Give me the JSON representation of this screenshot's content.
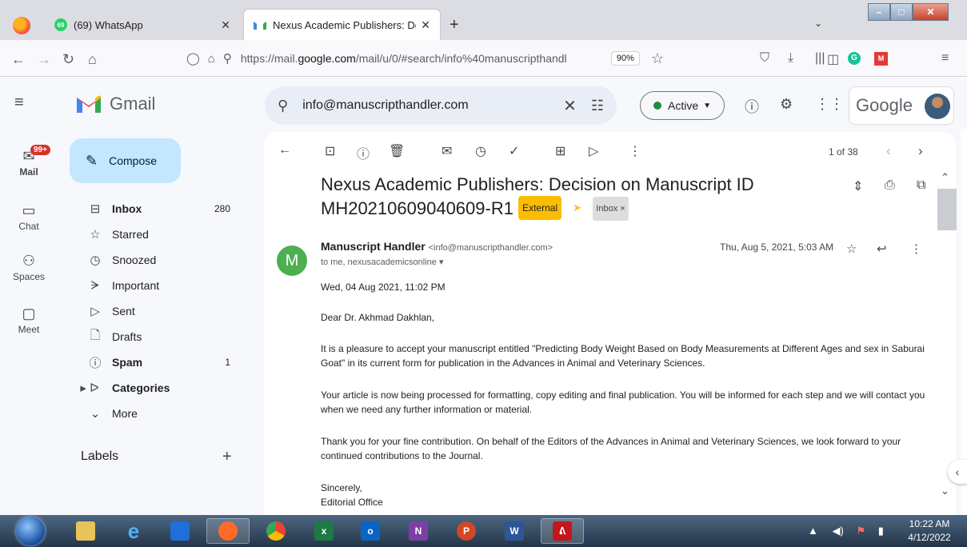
{
  "browser": {
    "tabs": [
      {
        "title": "(69) WhatsApp",
        "badge": "69"
      },
      {
        "title": "Nexus Academic Publishers: Dec"
      }
    ],
    "url_prefix": "https://mail.",
    "url_domain": "google.com",
    "url_suffix": "/mail/u/0/#search/info%40manuscripthandl",
    "zoom": "90%"
  },
  "gmail": {
    "app_name": "Gmail",
    "search_value": "info@manuscripthandler.com",
    "status": "Active",
    "google_word": "Google"
  },
  "rail": {
    "mail": "Mail",
    "mail_badge": "99+",
    "chat": "Chat",
    "spaces": "Spaces",
    "meet": "Meet"
  },
  "sidebar": {
    "compose": "Compose",
    "items": [
      {
        "label": "Inbox",
        "count": "280"
      },
      {
        "label": "Starred",
        "count": ""
      },
      {
        "label": "Snoozed",
        "count": ""
      },
      {
        "label": "Important",
        "count": ""
      },
      {
        "label": "Sent",
        "count": ""
      },
      {
        "label": "Drafts",
        "count": ""
      },
      {
        "label": "Spam",
        "count": "1"
      },
      {
        "label": "Categories",
        "count": ""
      },
      {
        "label": "More",
        "count": ""
      }
    ],
    "labels_header": "Labels"
  },
  "message": {
    "pager": "1 of 38",
    "subject": "Nexus Academic Publishers: Decision on Manuscript ID MH20210609040609-R1",
    "tag_external": "External",
    "tag_inbox": "Inbox ×",
    "sender_initial": "M",
    "sender_name": "Manuscript Handler",
    "sender_email": "<info@manuscripthandler.com>",
    "to": "to me, nexusacademicsonline ▾",
    "date": "Thu, Aug 5, 2021, 5:03 AM",
    "body": [
      "Wed, 04 Aug 2021, 11:02 PM",
      "Dear Dr. Akhmad Dakhlan,",
      "It is a pleasure to accept your manuscript entitled \"Predicting Body Weight Based on Body Measurements at Different Ages and sex in Saburai Goat\" in its current form for publication in the Advances in Animal and Veterinary Sciences.",
      "Your article is now being processed for formatting, copy editing and final publication. You will be informed for each step and we will contact you when we need any further information or material.",
      "Thank you for your fine contribution. On behalf of the Editors of the Advances in Animal and Veterinary Sciences, we look forward to your continued contributions to the Journal.",
      "Sincerely,",
      "Editorial Office"
    ]
  },
  "taskbar": {
    "time": "10:22 AM",
    "date": "4/12/2022"
  },
  "colors": {
    "gmail_bg": "#f6f8fc",
    "compose": "#c2e7ff",
    "external_tag": "#fbbc04",
    "active_dot": "#1e8e3e",
    "sender_avatar": "#4caf50"
  }
}
